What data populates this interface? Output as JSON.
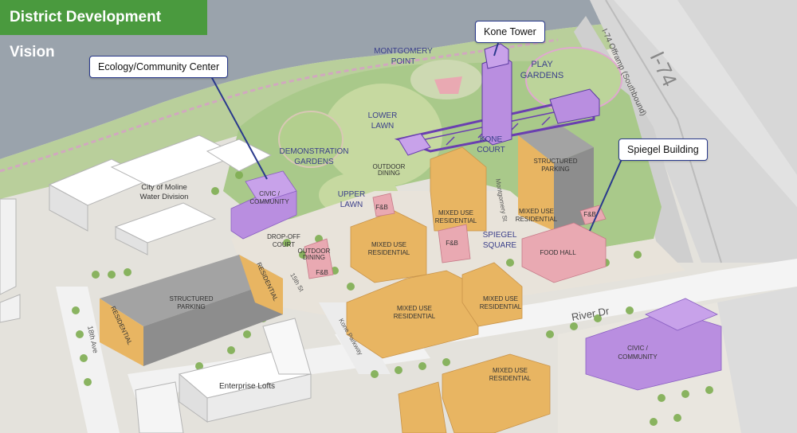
{
  "title": "District Development Vision",
  "callouts": {
    "kone_tower": "Kone Tower",
    "ecology_center": "Ecology/Community Center",
    "spiegel_building": "Spiegel Building"
  },
  "areas": {
    "montgomery_point": [
      "MONTGOMERY",
      "POINT"
    ],
    "play_gardens": [
      "PLAY",
      "GARDENS"
    ],
    "lower_lawn": [
      "LOWER",
      "LAWN"
    ],
    "demonstration_gardens": [
      "DEMONSTRATION",
      "GARDENS"
    ],
    "kone_court": [
      "KONE",
      "COURT"
    ],
    "upper_lawn": [
      "UPPER",
      "LAWN"
    ],
    "spiegel_square": [
      "SPIEGEL",
      "SQUARE"
    ],
    "drop_off_court": [
      "DROP-OFF",
      "COURT"
    ]
  },
  "buildings": {
    "civic_community_1": [
      "CIVIC /",
      "COMMUNITY"
    ],
    "civic_community_2": [
      "CIVIC /",
      "COMMUNITY"
    ],
    "structured_parking_1": [
      "STRUCTURED",
      "PARKING"
    ],
    "structured_parking_2": [
      "STRUCTURED",
      "PARKING"
    ],
    "mixed_use_1": [
      "MIXED USE",
      "RESIDENTIAL"
    ],
    "mixed_use_2": [
      "MIXED USE",
      "RESIDENTIAL"
    ],
    "mixed_use_3": [
      "MIXED USE",
      "RESIDENTIAL"
    ],
    "mixed_use_4": [
      "MIXED USE",
      "RESIDENTIAL"
    ],
    "mixed_use_5": [
      "MIXED USE",
      "RESIDENTIAL"
    ],
    "mixed_use_6": [
      "MIXED USE",
      "RESIDENTIAL"
    ],
    "food_hall": "FOOD HALL",
    "fb": "F&B",
    "residential": "RESIDENTIAL",
    "outdoor_dining": [
      "OUTDOOR",
      "DINING"
    ],
    "water_division": [
      "City of Moline",
      "Water Division"
    ],
    "enterprise_lofts": "Enterprise Lofts"
  },
  "roads": {
    "i74": "I-74",
    "i74_offramp": "I-74 Offramp (Southbound)",
    "river_dr": "River Dr",
    "18th_ave": "18th Ave",
    "montgomery_st": "Montgomery St",
    "15th_st": "15th St",
    "kone_parkway": "Kone Parkway"
  },
  "colors": {
    "banner": "#4a9a3e",
    "water": "#9aa3ac",
    "park": "#a9c98a",
    "lawn": "#c6d9a0",
    "mixed_use": "#e8b562",
    "civic": "#b98ee0",
    "food": "#e9a9b2",
    "parking": "#8d8d8d",
    "existing": "#f1f1f1",
    "outline": "#2a3a8c"
  }
}
